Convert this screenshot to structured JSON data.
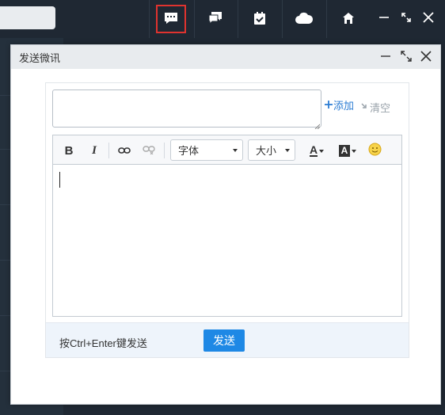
{
  "topbar": {
    "icons": [
      "chat-message-icon",
      "messages-icon",
      "task-calendar-icon",
      "cloud-icon",
      "home-icon"
    ],
    "window_controls": [
      "minimize-icon",
      "restore-icon",
      "close-icon"
    ]
  },
  "dialog": {
    "title": "发送微讯",
    "add_label": "添加",
    "clear_label": "清空",
    "toolbar": {
      "bold_label": "B",
      "italic_label": "I",
      "font_select_value": "字体",
      "size_select_value": "大小",
      "font_color_label": "A",
      "highlight_label": "A"
    },
    "hint": "按Ctrl+Enter键发送",
    "send_label": "发送"
  },
  "colors": {
    "accent": "#1e88e5",
    "link": "#2b7cd3",
    "topbar_bg": "#1f2833",
    "active_outline": "#e0332f"
  }
}
